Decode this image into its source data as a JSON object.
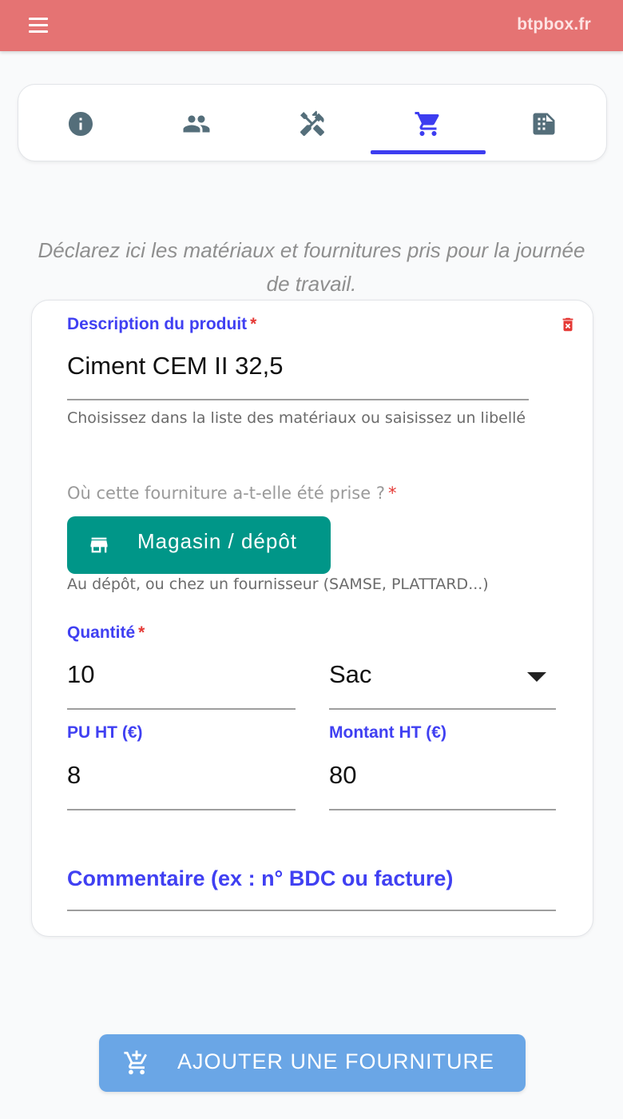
{
  "header": {
    "brand": "btpbox.fr",
    "menu_icon": "menu-icon"
  },
  "tabs": [
    {
      "icon": "info-icon",
      "active": false
    },
    {
      "icon": "people-icon",
      "active": false
    },
    {
      "icon": "tools-icon",
      "active": false
    },
    {
      "icon": "cart-icon",
      "active": true
    },
    {
      "icon": "document-icon",
      "active": false
    }
  ],
  "intro_text": "Déclarez ici les matériaux et fournitures pris pour la journée de travail.",
  "form": {
    "description_label": "Description du produit",
    "description_value": "Ciment CEM II 32,5",
    "description_hint": "Choisissez dans la liste des matériaux ou saisissez un libellé",
    "origin_label": "Où cette fourniture a-t-elle été prise ?",
    "origin_button": "Magasin / dépôt",
    "origin_hint": "Au dépôt, ou chez un fournisseur (SAMSE, PLATTARD...)",
    "quantity_label": "Quantité",
    "quantity_value": "10",
    "unit_value": "Sac",
    "pu_label": "PU HT (€)",
    "pu_value": "8",
    "amount_label": "Montant HT (€)",
    "amount_value": "80",
    "comment_label": "Commentaire (ex : n° BDC ou facture)",
    "required_mark": "*"
  },
  "add_button": "AJOUTER UNE FOURNITURE",
  "colors": {
    "topbar": "#e57373",
    "accent": "#4040f2",
    "store_button": "#009688",
    "add_button": "#6aa6e6",
    "danger": "#e53935"
  }
}
